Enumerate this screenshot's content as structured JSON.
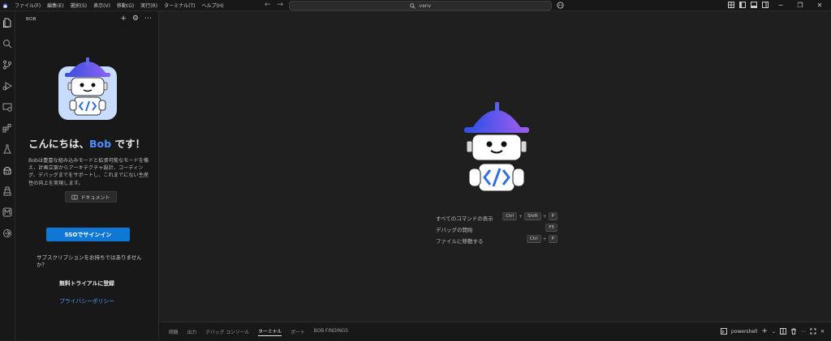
{
  "menu": [
    "ファイル(F)",
    "編集(E)",
    "選択(S)",
    "表示(V)",
    "移動(G)",
    "実行(R)",
    "ターミナル(T)",
    "ヘルプ(H)"
  ],
  "search": {
    "text": ".venv"
  },
  "sidebar": {
    "title": "BOB",
    "greeting_prefix": "こんにちは、",
    "greeting_name": "Bob",
    "greeting_suffix": " です！",
    "description": "Bobは豊富な組み込みモードと拡張可能なモードを備え、計画立案からアーキテクチャ設計、コーディング、デバッグまでをサポートし、これまでにない生産性の向上を実現します。",
    "docs_label": "ドキュメント",
    "sso_label": "SSOでサインイン",
    "subscription_question": "サブスクリプションをお持ちではありませんか？",
    "trial_label": "無料トライアルに登録",
    "privacy_label": "プライバシーポリシー"
  },
  "shortcuts": [
    {
      "label": "すべてのコマンドの表示",
      "keys": [
        "Ctrl",
        "Shift",
        "P"
      ]
    },
    {
      "label": "デバッグの開始",
      "keys": [
        "F5"
      ]
    },
    {
      "label": "ファイルに移動する",
      "keys": [
        "Ctrl",
        "P"
      ]
    }
  ],
  "panel": {
    "tabs": [
      "問題",
      "出力",
      "デバッグ コンソール",
      "ターミナル",
      "ポート",
      "BOB FINDINGS"
    ],
    "active_tab": "ターミナル",
    "terminal_name": "powershell"
  },
  "colors": {
    "accent": "#0f78d4",
    "brand": "#4d8dff",
    "link": "#4d9fff"
  }
}
